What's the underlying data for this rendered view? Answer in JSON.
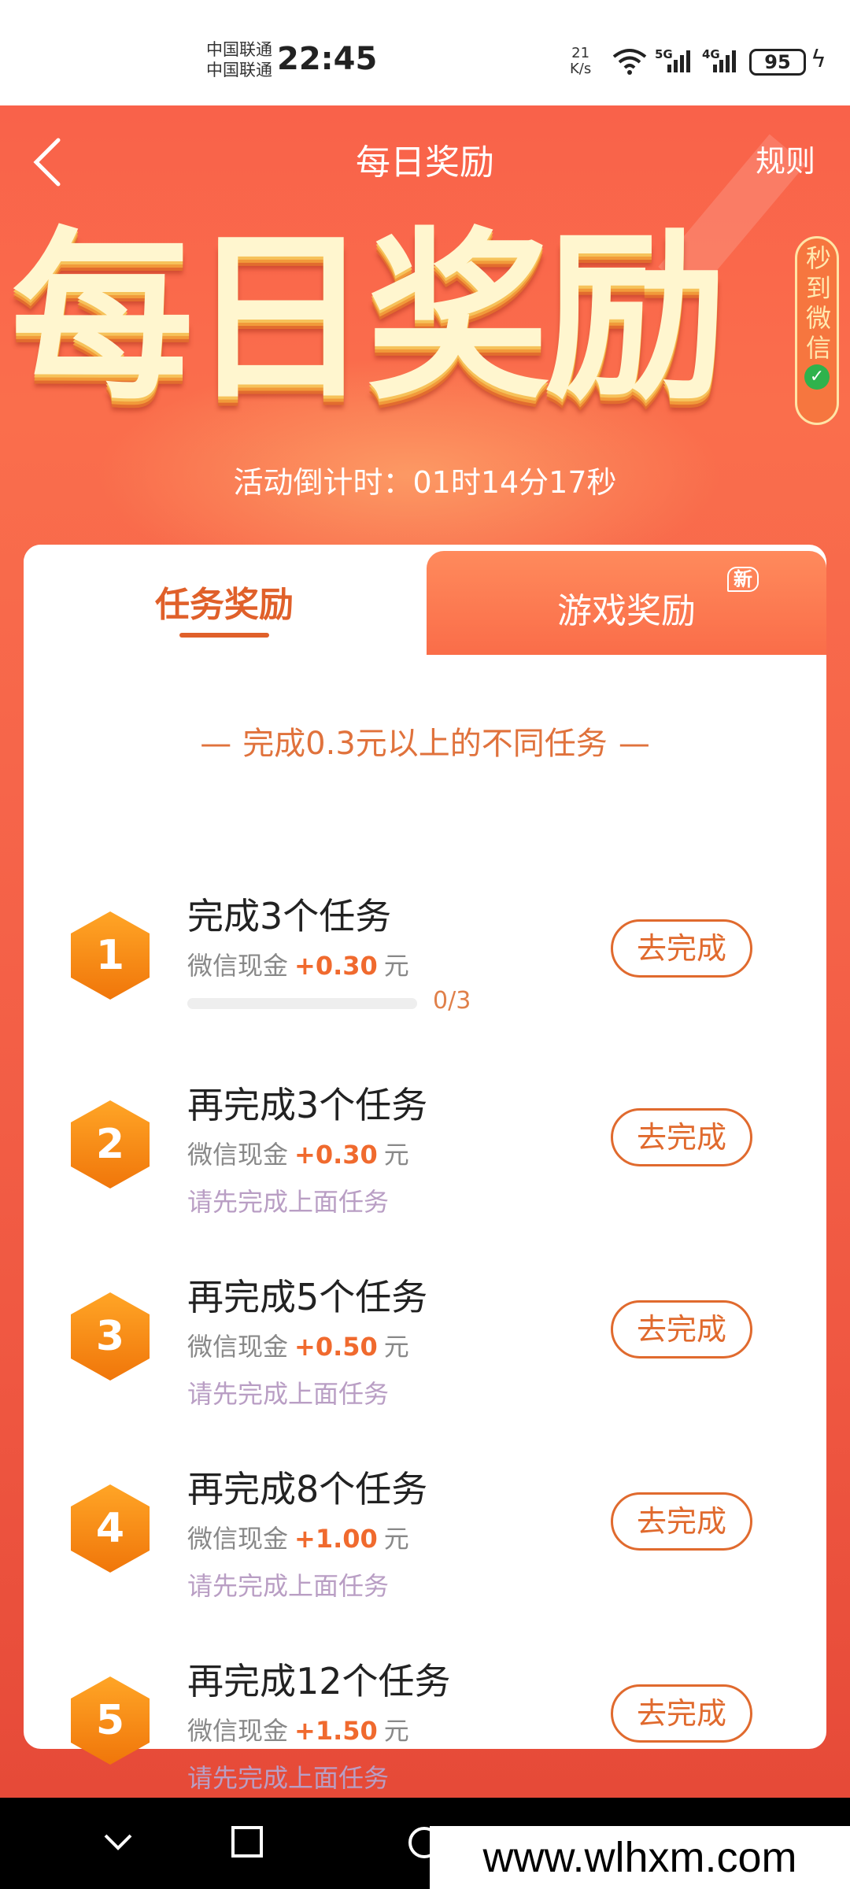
{
  "status_bar": {
    "carrier_1": "中国联通",
    "carrier_2": "中国联通",
    "time": "22:45",
    "speed_value": "21",
    "speed_unit": "K/s",
    "net_1": "5G",
    "net_2": "4G",
    "battery": "95"
  },
  "header": {
    "title": "每日奖励",
    "rules": "规则"
  },
  "hero": {
    "big_title": "每日奖励",
    "badge": "秒到微信",
    "countdown": "活动倒计时：01时14分17秒"
  },
  "tabs": [
    {
      "label": "任务奖励",
      "active": true
    },
    {
      "label": "游戏奖励",
      "active": false,
      "tag": "新"
    }
  ],
  "section_title": "完成0.3元以上的不同任务",
  "tasks": [
    {
      "index": "1",
      "title": "完成3个任务",
      "reward_prefix": "微信现金",
      "amount": "+0.30",
      "unit": "元",
      "progress_text": "0/3",
      "progress": 0,
      "button": "去完成"
    },
    {
      "index": "2",
      "title": "再完成3个任务",
      "reward_prefix": "微信现金",
      "amount": "+0.30",
      "unit": "元",
      "hint": "请先完成上面任务",
      "button": "去完成"
    },
    {
      "index": "3",
      "title": "再完成5个任务",
      "reward_prefix": "微信现金",
      "amount": "+0.50",
      "unit": "元",
      "hint": "请先完成上面任务",
      "button": "去完成"
    },
    {
      "index": "4",
      "title": "再完成8个任务",
      "reward_prefix": "微信现金",
      "amount": "+1.00",
      "unit": "元",
      "hint": "请先完成上面任务",
      "button": "去完成"
    },
    {
      "index": "5",
      "title": "再完成12个任务",
      "reward_prefix": "微信现金",
      "amount": "+1.50",
      "unit": "元",
      "hint": "请先完成上面任务",
      "button": "去完成"
    }
  ],
  "watermark": "www.wlhxm.com",
  "icons": {
    "back": "chevron-left-icon",
    "wifi": "wifi-icon",
    "battery": "battery-icon",
    "charging": "bolt-icon",
    "nav_back": "chevron-down-icon",
    "nav_home": "circle-icon",
    "nav_recent": "square-icon"
  },
  "colors": {
    "accent": "#f9624a",
    "button": "#e06a2e",
    "amount": "#f06a2e",
    "hex_top": "#ffa526",
    "hex_bottom": "#f0760a",
    "hint": "#b99ec4"
  }
}
